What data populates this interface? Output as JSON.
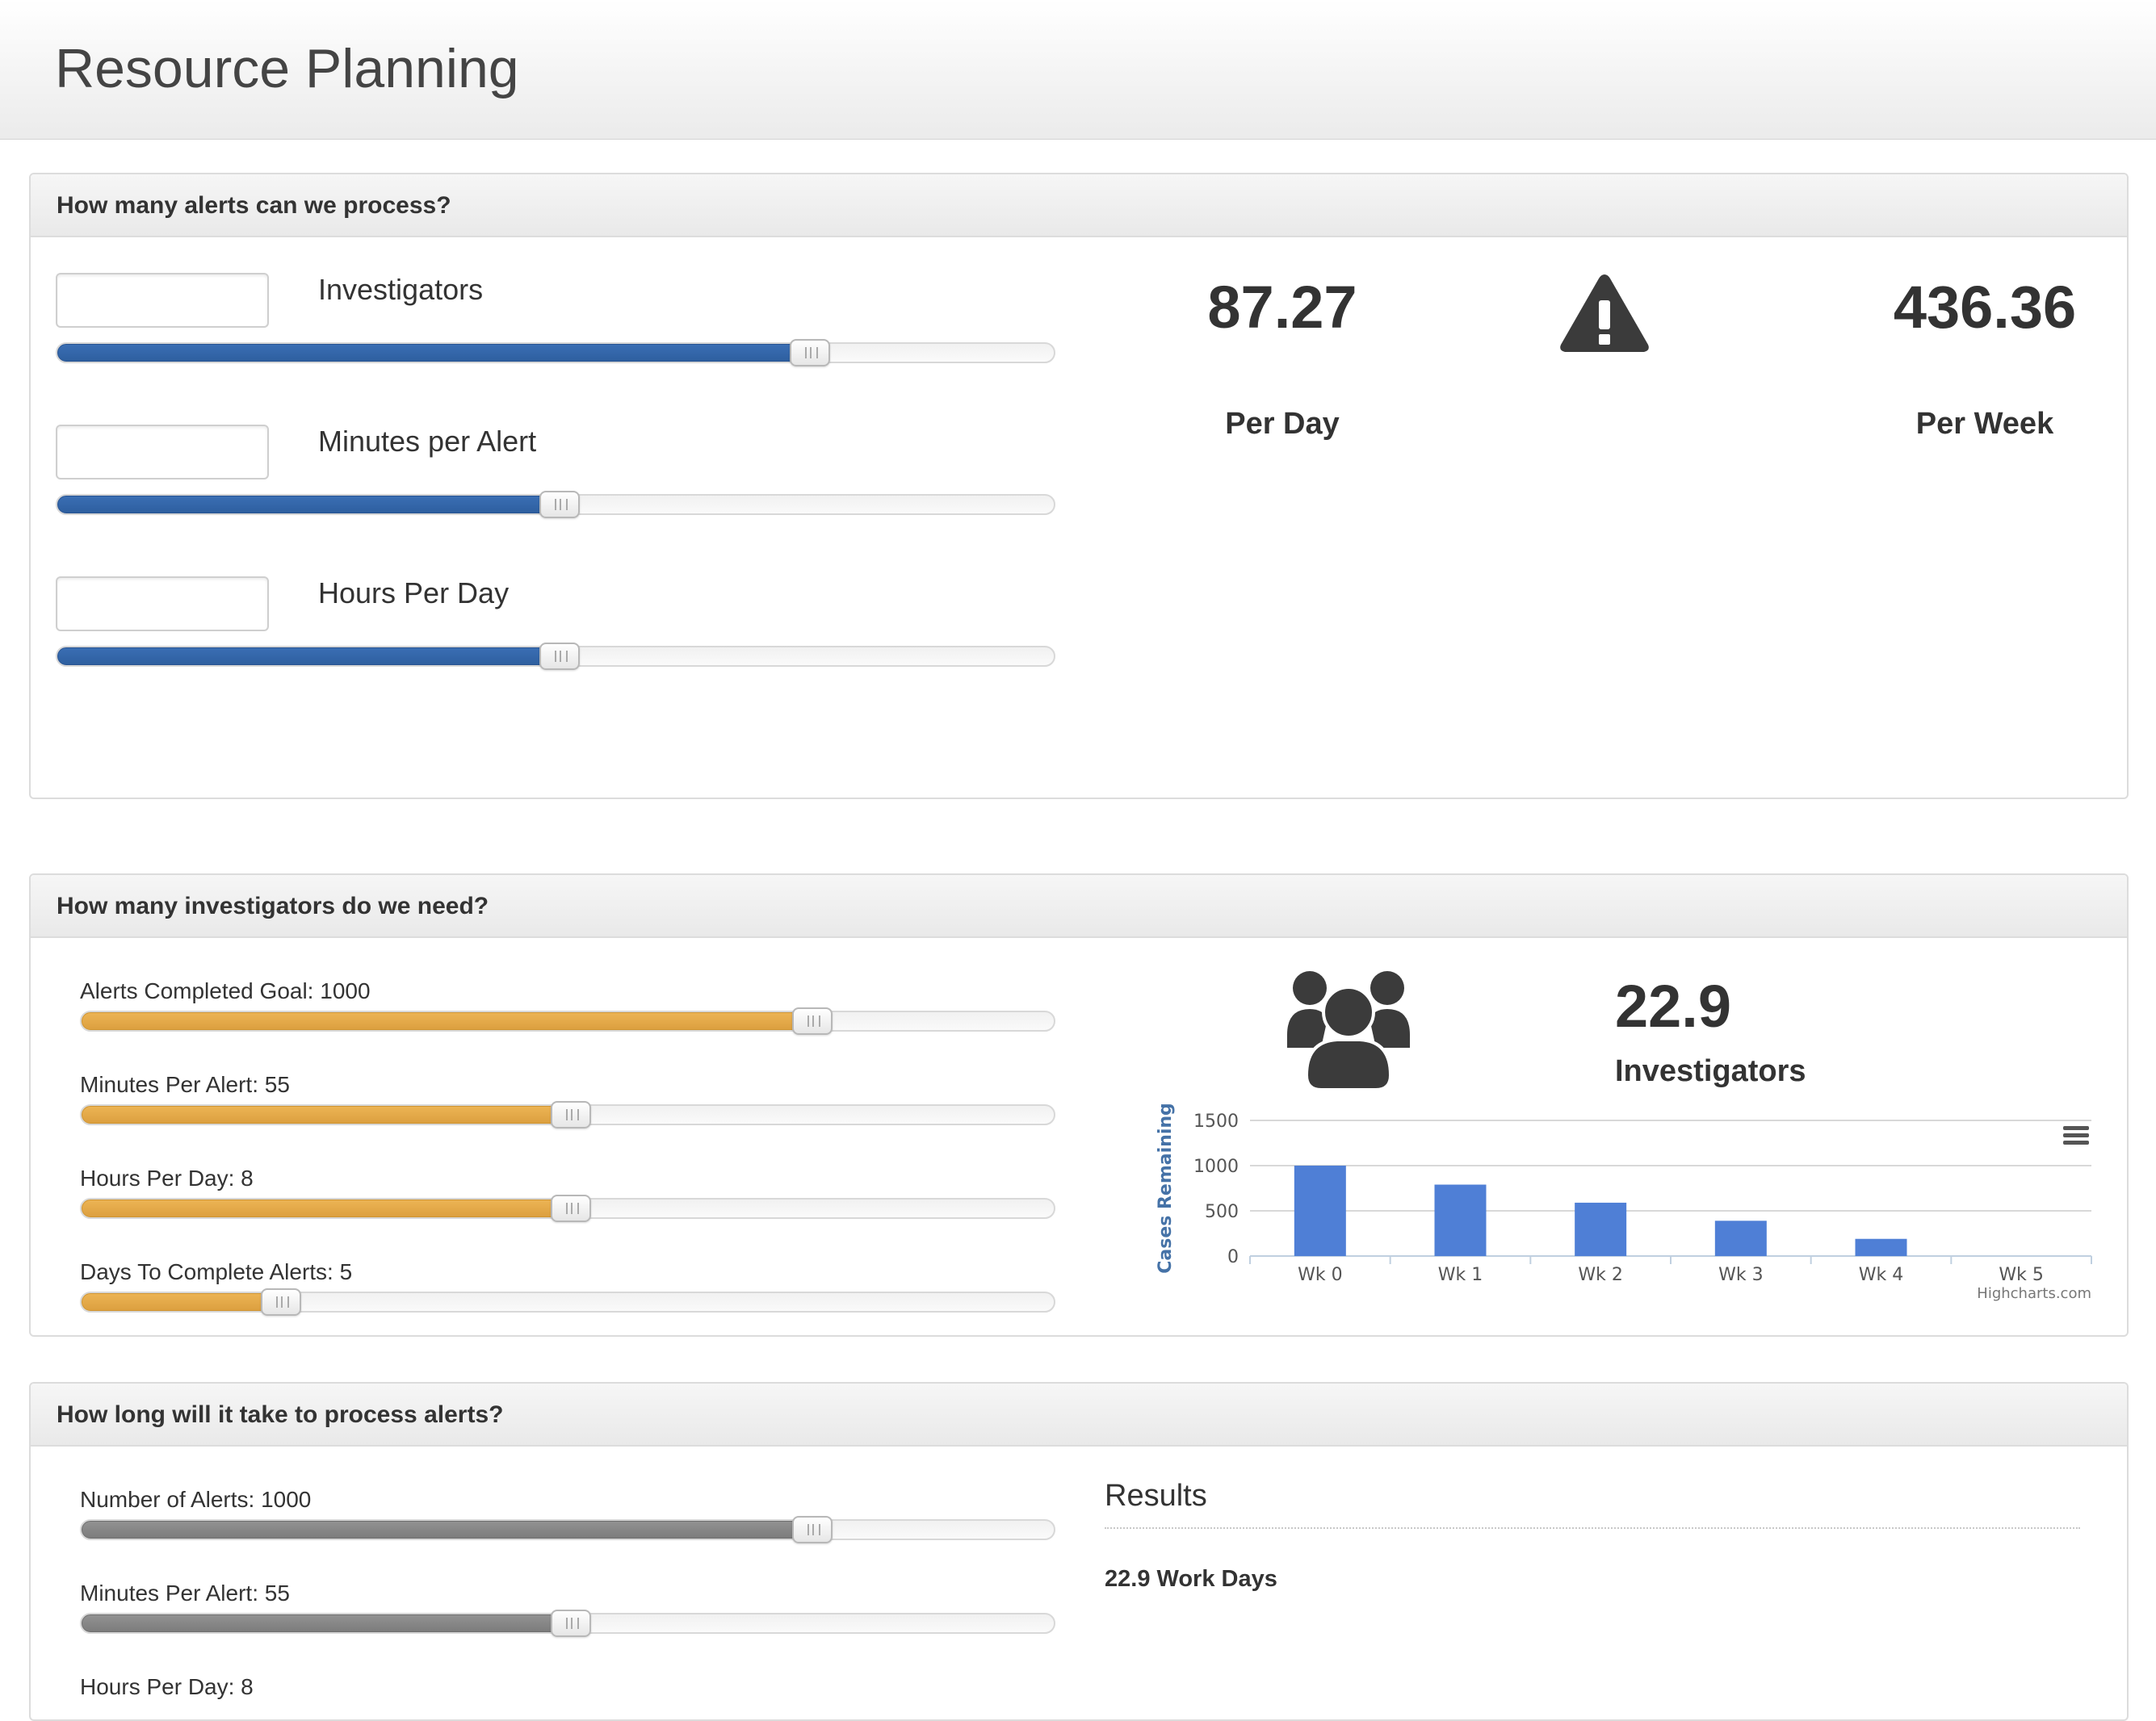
{
  "app": {
    "title": "Resource Planning"
  },
  "panel1": {
    "title": "How many alerts can we process?",
    "fields": [
      {
        "label": "Investigators",
        "value": "",
        "slider_fraction": 0.755
      },
      {
        "label": "Minutes per Alert",
        "value": "",
        "slider_fraction": 0.504
      },
      {
        "label": "Hours Per Day",
        "value": "",
        "slider_fraction": 0.504
      }
    ],
    "per_day_value": "87.27",
    "per_day_label": "Per Day",
    "warning_icon": "warning-triangle-icon",
    "per_week_value": "436.36",
    "per_week_label": "Per Week"
  },
  "panel2": {
    "title": "How many investigators do we need?",
    "sliders": [
      {
        "label": "Alerts Completed Goal: 1000",
        "fraction": 0.752
      },
      {
        "label": "Minutes Per Alert: 55",
        "fraction": 0.503
      },
      {
        "label": "Hours Per Day: 8",
        "fraction": 0.503
      },
      {
        "label": "Days To Complete Alerts: 5",
        "fraction": 0.205
      }
    ],
    "icon": "group-users-icon",
    "investigators_value": "22.9",
    "investigators_label": "Investigators",
    "chart_credit": "Highcharts.com",
    "menu_icon": "hamburger-menu-icon",
    "accent_color": "#4f7fd6"
  },
  "panel3": {
    "title": "How long will it take to process alerts?",
    "sliders": [
      {
        "label": "Number of Alerts: 1000",
        "fraction": 0.752
      },
      {
        "label": "Minutes Per Alert: 55",
        "fraction": 0.503
      },
      {
        "label": "Hours Per Day: 8",
        "fraction": 0.503
      }
    ],
    "results_heading": "Results",
    "results_value": "22.9 Work Days"
  },
  "chart_data": {
    "type": "bar",
    "categories": [
      "Wk 0",
      "Wk 1",
      "Wk 2",
      "Wk 3",
      "Wk 4",
      "Wk 5"
    ],
    "series": [
      {
        "values": [
          1000,
          790,
          590,
          390,
          190,
          0
        ]
      }
    ],
    "title": "",
    "xlabel": "",
    "ylabel": "Cases Remaining",
    "ylim": [
      0,
      1500
    ],
    "yticks": [
      0,
      500,
      1000,
      1500
    ],
    "grid": true,
    "legend": "none",
    "color": "#4f7fd6"
  }
}
